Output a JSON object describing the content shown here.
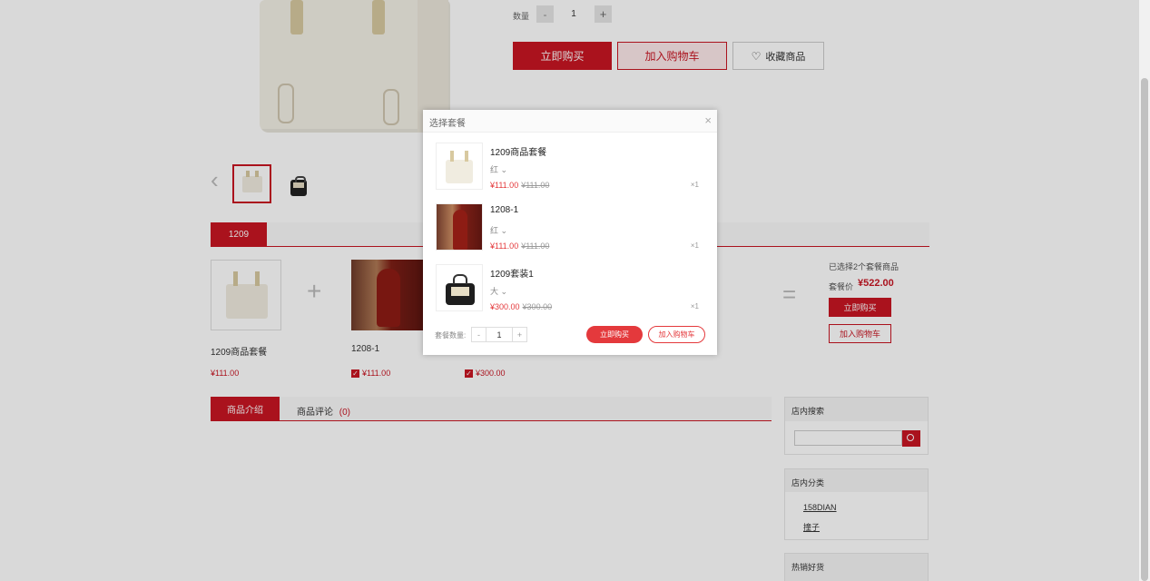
{
  "detail": {
    "qty_label": "数量",
    "qty_minus": "-",
    "qty_value": "1",
    "qty_plus": "+",
    "buy_now": "立即购买",
    "add_cart": "加入购物车",
    "favorite": "收藏商品"
  },
  "gallery": {
    "prev_arrow": "‹"
  },
  "package": {
    "tab_label": "1209",
    "plus_sign": "+",
    "equals_sign": "=",
    "items": [
      {
        "name": "1209商品套餐",
        "price": "¥111.00"
      },
      {
        "name": "1208-1",
        "price": "¥111.00"
      },
      {
        "name": "",
        "price": "¥300.00"
      }
    ],
    "selected_text": "已选择2个套餐商品",
    "price_label": "套餐价",
    "price_value": "¥522.00",
    "buy_now": "立即购买",
    "add_cart": "加入购物车"
  },
  "tabs": {
    "intro": "商品介绍",
    "reviews": "商品评论",
    "review_count": "(0)"
  },
  "sidebar": {
    "search_title": "店内搜索",
    "search_value": "",
    "category_title": "店内分类",
    "categories": [
      "158DIAN",
      "撞子"
    ],
    "hot_title": "热销好货"
  },
  "modal": {
    "title": "选择套餐",
    "close": "×",
    "items": [
      {
        "name": "1209商品套餐",
        "spec": "红",
        "price": "¥111.00",
        "orig": "¥111.00",
        "qty": "×1"
      },
      {
        "name": "1208-1",
        "spec": "红",
        "price": "¥111.00",
        "orig": "¥111.00",
        "qty": "×1"
      },
      {
        "name": "1209套装1",
        "spec": "大",
        "price": "¥300.00",
        "orig": "¥300.00",
        "qty": "×1"
      }
    ],
    "qty_label": "套餐数量:",
    "qty_minus": "-",
    "qty_value": "1",
    "qty_plus": "+",
    "buy_now": "立即购买",
    "add_cart": "加入购物车"
  },
  "colors": {
    "accent": "#c81623",
    "price": "#e4393c"
  }
}
